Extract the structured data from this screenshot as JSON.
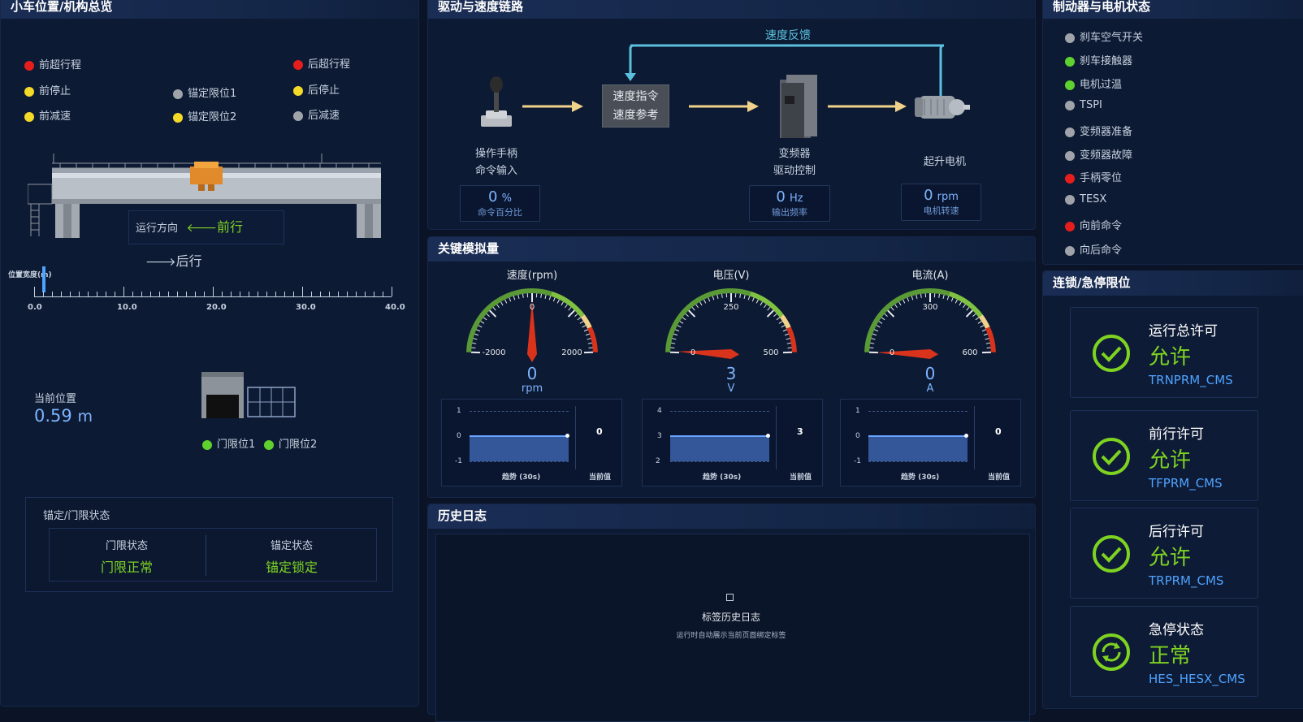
{
  "left_panel": {
    "title": "小车位置/机构总览",
    "limits": [
      {
        "label": "前超行程",
        "color": "red"
      },
      {
        "label": "前停止",
        "color": "yellow"
      },
      {
        "label": "前减速",
        "color": "yellow"
      },
      {
        "label": "锚定限位1",
        "color": "gray"
      },
      {
        "label": "锚定限位2",
        "color": "yellow"
      },
      {
        "label": "后超行程",
        "color": "red"
      },
      {
        "label": "后停止",
        "color": "yellow"
      },
      {
        "label": "后减速",
        "color": "gray"
      }
    ],
    "direction": {
      "label": "运行方向",
      "forward": "前行",
      "backward": "后行"
    },
    "ruler": {
      "title": "位置宽度(m)",
      "ticks": [
        "0.0",
        "10.0",
        "20.0",
        "30.0",
        "40.0"
      ],
      "min": 0,
      "max": 40,
      "marker_value": 0.59
    },
    "current_position": {
      "label": "当前位置",
      "value": "0.59",
      "unit": "m"
    },
    "door_limits": [
      {
        "label": "门限位1"
      },
      {
        "label": "门限位2"
      }
    ],
    "anchor_door_status": {
      "title": "锚定/门限状态",
      "door_label": "门限状态",
      "door_value": "门限正常",
      "anchor_label": "锚定状态",
      "anchor_value": "锚定锁定"
    }
  },
  "drive_panel": {
    "title": "驱动与速度链路",
    "feedback_label": "速度反馈",
    "speed_box": {
      "line1": "速度指令",
      "line2": "速度参考"
    },
    "nodes": [
      {
        "line1": "操作手柄",
        "line2": "命令输入",
        "value": "0",
        "unit": "%",
        "sub": "命令百分比"
      },
      {
        "line1": "变频器",
        "line2": "驱动控制",
        "value": "0",
        "unit": "Hz",
        "sub": "输出频率"
      },
      {
        "line1": "起升电机",
        "line2": "",
        "value": "0",
        "unit": "rpm",
        "sub": "电机转速"
      }
    ]
  },
  "analog_panel": {
    "title": "关键模拟量",
    "gauges": [
      {
        "title": "速度(rpm)",
        "min_label": "-2000",
        "mid_label": "0",
        "max_label": "2000",
        "min": -2000,
        "max": 2000,
        "value": 0,
        "value_text": "0",
        "unit": "rpm",
        "trend": {
          "y_top": "1",
          "y_mid": "0",
          "y_bot": "-1",
          "current": "0",
          "trend_label": "趋势 (30s)",
          "current_label": "当前值"
        }
      },
      {
        "title": "电压(V)",
        "min_label": "0",
        "mid_label": "250",
        "max_label": "500",
        "min": 0,
        "max": 500,
        "value": 3,
        "value_text": "3",
        "unit": "V",
        "trend": {
          "y_top": "4",
          "y_mid": "3",
          "y_bot": "2",
          "current": "3",
          "trend_label": "趋势 (30s)",
          "current_label": "当前值"
        }
      },
      {
        "title": "电流(A)",
        "min_label": "0",
        "mid_label": "300",
        "max_label": "600",
        "min": 0,
        "max": 600,
        "value": 0,
        "value_text": "0",
        "unit": "A",
        "trend": {
          "y_top": "1",
          "y_mid": "0",
          "y_bot": "-1",
          "current": "0",
          "trend_label": "趋势 (30s)",
          "current_label": "当前值"
        }
      }
    ]
  },
  "history_panel": {
    "title": "历史日志",
    "empty_title": "标签历史日志",
    "empty_desc": "运行时自动展示当前页面绑定标签"
  },
  "brake_panel": {
    "title": "制动器与电机状态",
    "items": [
      {
        "label": "刹车空气开关",
        "color": "gray"
      },
      {
        "label": "刹车接触器",
        "color": "green"
      },
      {
        "label": "电机过温",
        "color": "green"
      },
      {
        "label": "TSPI",
        "color": "gray"
      },
      {
        "label": "变频器准备",
        "color": "gray"
      },
      {
        "label": "变频器故障",
        "color": "gray"
      },
      {
        "label": "手柄零位",
        "color": "red"
      },
      {
        "label": "TESX",
        "color": "gray"
      },
      {
        "label": "向前命令",
        "color": "red"
      },
      {
        "label": "向后命令",
        "color": "gray"
      }
    ]
  },
  "interlock_panel": {
    "title": "连锁/急停限位",
    "items": [
      {
        "title": "运行总许可",
        "state": "允许",
        "tag": "TRNPRM_CMS",
        "icon": "check-circle-icon"
      },
      {
        "title": "前行许可",
        "state": "允许",
        "tag": "TFPRM_CMS",
        "icon": "check-circle-icon"
      },
      {
        "title": "后行许可",
        "state": "允许",
        "tag": "TRPRM_CMS",
        "icon": "check-circle-icon"
      },
      {
        "title": "急停状态",
        "state": "正常",
        "tag": "HES_HESX_CMS",
        "icon": "cycle-circle-icon"
      }
    ]
  },
  "colors": {
    "accent_green": "#7ed321",
    "accent_blue": "#4ea3ff",
    "value_blue": "#7db4ff",
    "arrow": "#f0d28a",
    "feedback": "#5bc0de"
  }
}
